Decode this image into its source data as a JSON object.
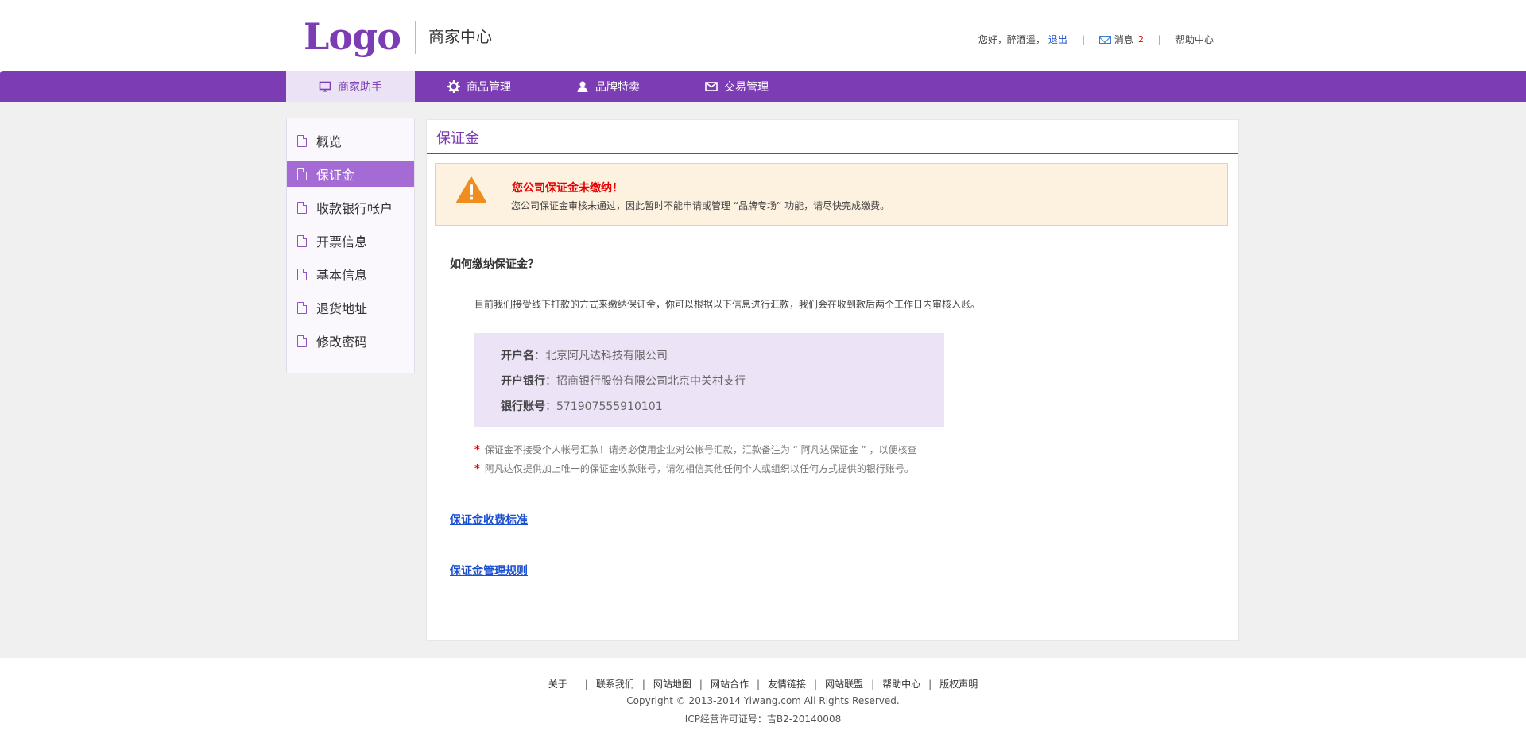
{
  "header": {
    "logo": "Logo",
    "site_title": "商家中心",
    "greeting": "您好，醉酒遥，",
    "logout": "退出",
    "messages_label": "消息",
    "messages_count": "2",
    "help": "帮助中心",
    "separator": "|"
  },
  "nav": {
    "items": [
      {
        "label": "商家助手",
        "icon": "monitor-icon"
      },
      {
        "label": "商品管理",
        "icon": "gear-icon"
      },
      {
        "label": "品牌特卖",
        "icon": "user-icon"
      },
      {
        "label": "交易管理",
        "icon": "mail-icon"
      }
    ]
  },
  "sidebar": {
    "items": [
      {
        "label": "概览"
      },
      {
        "label": "保证金"
      },
      {
        "label": "收款银行帐户"
      },
      {
        "label": "开票信息"
      },
      {
        "label": "基本信息"
      },
      {
        "label": "退货地址"
      },
      {
        "label": "修改密码"
      }
    ]
  },
  "main": {
    "title": "保证金",
    "alert_title": "您公司保证金未缴纳！",
    "alert_text": "您公司保证金审核未通过，因此暂时不能申请或管理 “品牌专场” 功能，请尽快完成缴费。",
    "how_title": "如何缴纳保证金？",
    "how_text": "目前我们接受线下打款的方式来缴纳保证金，你可以根据以下信息进行汇款，我们会在收到款后两个工作日内审核入账。",
    "bank": {
      "name_label": "开户名",
      "name_value": "：北京阿凡达科技有限公司",
      "bank_label": "开户银行",
      "bank_value": "：招商银行股份有限公司北京中关村支行",
      "account_label": "银行账号",
      "account_value": "：571907555910101"
    },
    "note_star": "*",
    "notes": [
      "保证金不接受个人帐号汇款！请务必使用企业对公帐号汇款，汇款备注为 “ 阿凡达保证金 ” ，以便核查",
      "阿凡达仅提供加上唯一的保证金收款账号，请勿相信其他任何个人或组织以任何方式提供的银行账号。"
    ],
    "link_fees": "保证金收费标准",
    "link_rules": "保证金管理规则"
  },
  "footer": {
    "links": [
      "关于",
      "联系我们",
      "网站地图",
      "网站合作",
      "友情链接",
      "网站联盟",
      "帮助中心",
      "版权声明"
    ],
    "separator": "|",
    "copyright": "Copyright © 2013-2014 Yiwang.com All Rights Reserved.",
    "icp": "ICP经营许可证号：吉B2-20140008"
  },
  "colors": {
    "brand": "#7b3cb4",
    "sidebar_active": "#a36bd3",
    "alert_bg": "#fdf1e0",
    "alert_text": "#e60000",
    "bank_box_bg": "#ece3f6"
  }
}
